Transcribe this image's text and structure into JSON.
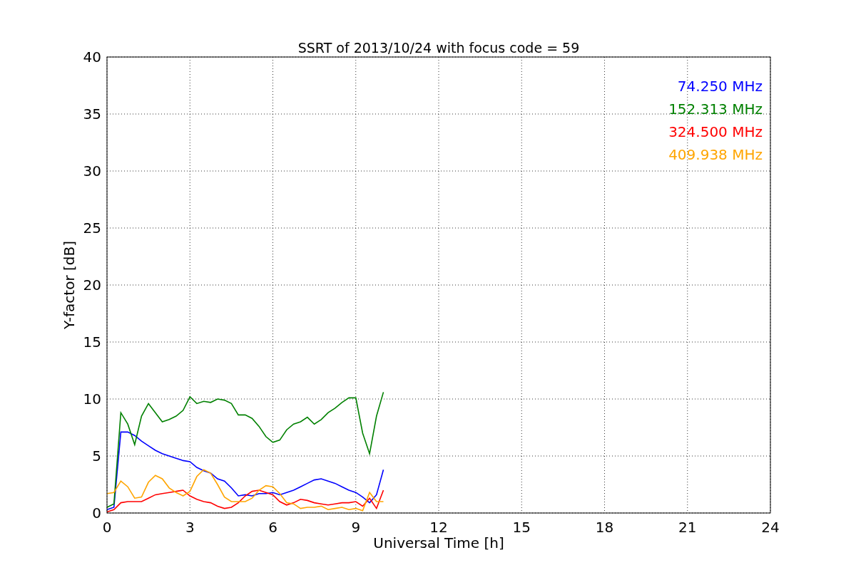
{
  "chart_data": {
    "type": "line",
    "title": "SSRT of 2013/10/24 with focus code = 59",
    "xlabel": "Universal Time [h]",
    "ylabel": "Y-factor [dB]",
    "x": [
      0,
      0.25,
      0.5,
      0.75,
      1,
      1.25,
      1.5,
      1.75,
      2,
      2.25,
      2.5,
      2.75,
      3,
      3.25,
      3.5,
      3.75,
      4,
      4.25,
      4.5,
      4.75,
      5,
      5.25,
      5.5,
      5.75,
      6,
      6.25,
      6.5,
      6.75,
      7,
      7.25,
      7.5,
      7.75,
      8,
      8.25,
      8.5,
      8.75,
      9,
      9.25,
      9.5,
      9.75,
      10
    ],
    "series": [
      {
        "name": "74.250 MHz",
        "color": "#0000ff",
        "values": [
          0.3,
          0.5,
          7.1,
          7.1,
          6.8,
          6.3,
          5.9,
          5.5,
          5.2,
          5.0,
          4.8,
          4.6,
          4.5,
          4.0,
          3.7,
          3.5,
          3.0,
          2.8,
          2.2,
          1.5,
          1.6,
          1.5,
          1.7,
          1.7,
          1.8,
          1.6,
          1.8,
          2.0,
          2.3,
          2.6,
          2.9,
          3.0,
          2.8,
          2.6,
          2.3,
          2.0,
          1.8,
          1.4,
          0.9,
          1.6,
          3.8
        ]
      },
      {
        "name": "152.313 MHz",
        "color": "#008000",
        "values": [
          0.5,
          0.8,
          8.8,
          7.8,
          6.0,
          8.5,
          9.6,
          8.8,
          8.0,
          8.2,
          8.5,
          9.0,
          10.2,
          9.6,
          9.8,
          9.7,
          10.0,
          9.9,
          9.6,
          8.6,
          8.6,
          8.3,
          7.6,
          6.7,
          6.2,
          6.4,
          7.3,
          7.8,
          8.0,
          8.4,
          7.8,
          8.2,
          8.8,
          9.2,
          9.7,
          10.1,
          10.1,
          7.0,
          5.2,
          8.5,
          10.6
        ]
      },
      {
        "name": "324.500 MHz",
        "color": "#ff0000",
        "values": [
          0.1,
          0.3,
          0.9,
          1.0,
          1.0,
          1.0,
          1.3,
          1.6,
          1.7,
          1.8,
          1.9,
          2.0,
          1.5,
          1.2,
          1.0,
          0.9,
          0.6,
          0.4,
          0.5,
          0.9,
          1.5,
          1.9,
          2.0,
          1.8,
          1.6,
          1.0,
          0.7,
          0.9,
          1.2,
          1.1,
          0.9,
          0.8,
          0.7,
          0.8,
          0.9,
          0.9,
          1.0,
          0.6,
          1.3,
          0.4,
          2.0
        ]
      },
      {
        "name": "409.938 MHz",
        "color": "#ffa500",
        "values": [
          1.7,
          1.8,
          2.8,
          2.3,
          1.3,
          1.4,
          2.7,
          3.3,
          3.0,
          2.2,
          1.8,
          1.5,
          1.9,
          3.2,
          3.8,
          3.5,
          2.5,
          1.4,
          1.0,
          1.0,
          1.0,
          1.3,
          2.0,
          2.4,
          2.3,
          1.7,
          0.9,
          0.8,
          0.4,
          0.5,
          0.5,
          0.6,
          0.3,
          0.4,
          0.5,
          0.3,
          0.4,
          0.2,
          1.8,
          1.0,
          1.0
        ]
      }
    ],
    "xlim": [
      0,
      24
    ],
    "ylim": [
      0,
      40
    ],
    "xticks": [
      0,
      3,
      6,
      9,
      12,
      15,
      18,
      21,
      24
    ],
    "yticks": [
      0,
      5,
      10,
      15,
      20,
      25,
      30,
      35,
      40
    ],
    "grid": true
  }
}
